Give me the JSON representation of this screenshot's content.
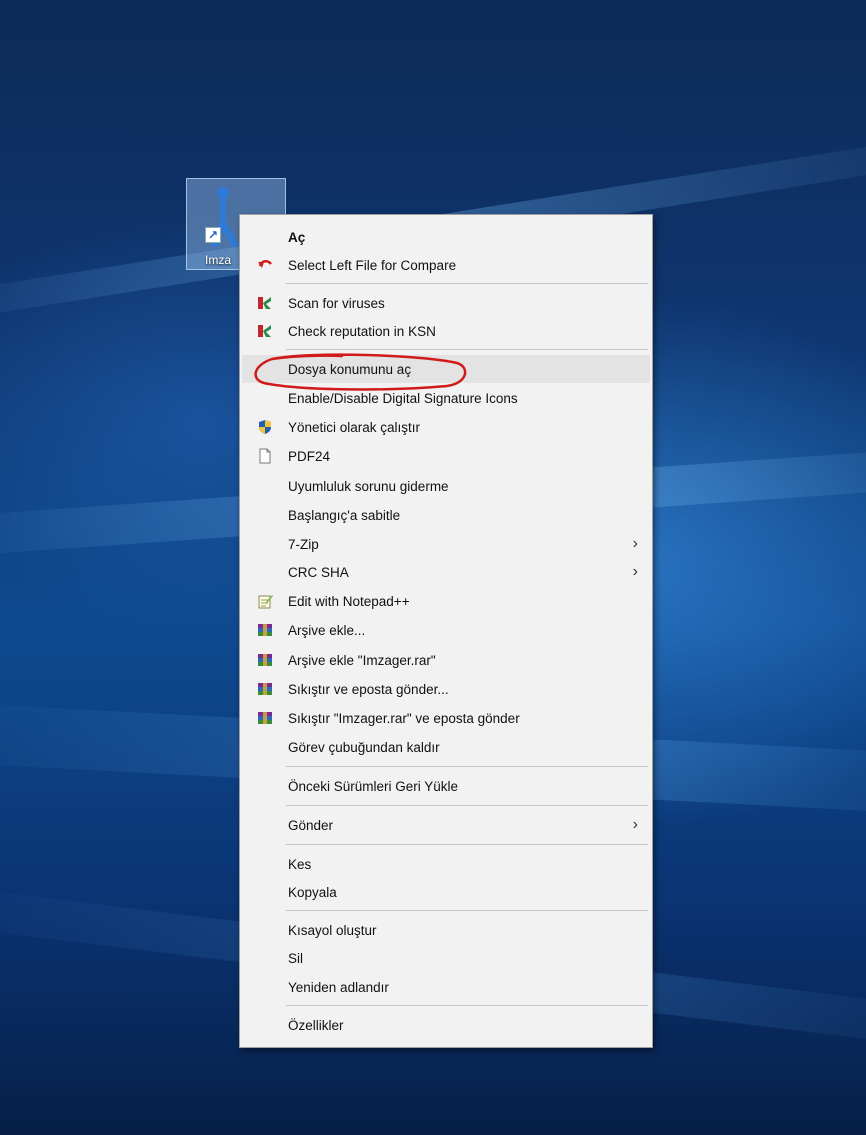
{
  "desktop": {
    "icon_label": "Imza"
  },
  "context_menu": {
    "items": [
      {
        "label": "Aç",
        "icon": "none"
      },
      {
        "label": "Select Left File for Compare",
        "icon": "compare-undo-icon"
      },
      {
        "label": "Scan for viruses",
        "icon": "kaspersky-icon"
      },
      {
        "label": "Check reputation in KSN",
        "icon": "kaspersky-icon"
      },
      {
        "label": "Dosya konumunu aç",
        "icon": "none"
      },
      {
        "label": "Enable/Disable Digital Signature Icons",
        "icon": "none"
      },
      {
        "label": "Yönetici olarak çalıştır",
        "icon": "uac-shield-icon"
      },
      {
        "label": "PDF24",
        "icon": "document-icon"
      },
      {
        "label": "Uyumluluk sorunu giderme",
        "icon": "none"
      },
      {
        "label": "Başlangıç'a sabitle",
        "icon": "none"
      },
      {
        "label": "7-Zip",
        "icon": "none",
        "submenu": true
      },
      {
        "label": "CRC SHA",
        "icon": "none",
        "submenu": true
      },
      {
        "label": "Edit with Notepad++",
        "icon": "notepad-plus-icon"
      },
      {
        "label": "Arşive ekle...",
        "icon": "winrar-icon"
      },
      {
        "label": "Arşive ekle \"Imzager.rar\"",
        "icon": "winrar-icon"
      },
      {
        "label": "Sıkıştır ve eposta gönder...",
        "icon": "winrar-icon"
      },
      {
        "label": "Sıkıştır \"Imzager.rar\" ve eposta gönder",
        "icon": "winrar-icon"
      },
      {
        "label": "Görev çubuğundan kaldır",
        "icon": "none"
      },
      {
        "label": "Önceki Sürümleri Geri Yükle",
        "icon": "none"
      },
      {
        "label": "Gönder",
        "icon": "none",
        "submenu": true
      },
      {
        "label": "Kes",
        "icon": "none"
      },
      {
        "label": "Kopyala",
        "icon": "none"
      },
      {
        "label": "Kısayol oluştur",
        "icon": "none"
      },
      {
        "label": "Sil",
        "icon": "none"
      },
      {
        "label": "Yeniden adlandır",
        "icon": "none"
      },
      {
        "label": "Özellikler",
        "icon": "none"
      }
    ],
    "submenu_arrow": "›",
    "highlighted_item": "Dosya konumunu aç"
  },
  "colors": {
    "annotation": "#d11a1a",
    "menu_bg": "#f2f2f2",
    "hover_bg": "#e3e3e3"
  }
}
